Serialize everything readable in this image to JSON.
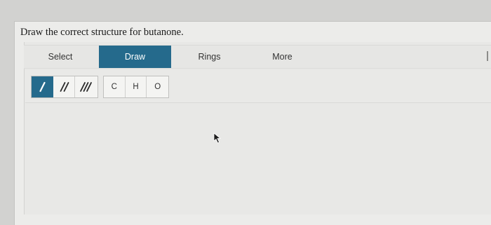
{
  "question": {
    "text": "Draw the correct structure for butanone."
  },
  "tabs": [
    {
      "label": "Select",
      "active": false
    },
    {
      "label": "Draw",
      "active": true
    },
    {
      "label": "Rings",
      "active": false
    },
    {
      "label": "More",
      "active": false
    }
  ],
  "bond_tools": [
    {
      "name": "single-bond",
      "icon": "single-bond-icon",
      "active": true
    },
    {
      "name": "double-bond",
      "icon": "double-bond-icon",
      "active": false
    },
    {
      "name": "triple-bond",
      "icon": "triple-bond-icon",
      "active": false
    }
  ],
  "atom_tools": [
    {
      "label": "C"
    },
    {
      "label": "H"
    },
    {
      "label": "O"
    }
  ],
  "colors": {
    "accent": "#256a8c",
    "background": "#ececea",
    "tool_background": "#f4f4f2"
  },
  "cursor": {
    "icon": "mouse-pointer-icon"
  }
}
